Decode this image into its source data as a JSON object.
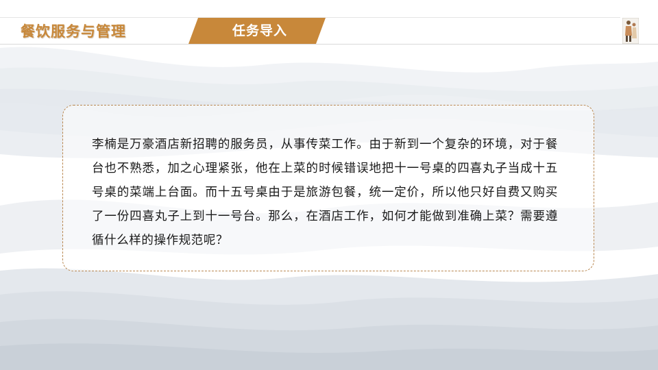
{
  "header": {
    "course_title": "餐饮服务与管理",
    "section_label": "任务导入"
  },
  "content": {
    "paragraph": "李楠是万豪酒店新招聘的服务员，从事传菜工作。由于新到一个复杂的环境，对于餐台也不熟悉，加之心理紧张，他在上菜的时候错误地把十一号桌的四喜丸子当成十五号桌的菜端上台面。而十五号桌由于是旅游包餐，统一定价，所以他只好自费又购买了一份四喜丸子上到十一号台。那么，在酒店工作，如何才能做到准确上菜？需要遵循什么样的操作规范呢？"
  },
  "colors": {
    "accent": "#c8883a",
    "tab_fill": "#c8883a",
    "box_border": "#b8864e",
    "wave_dark": "#dfe3e8",
    "wave_light": "#eef0f3"
  }
}
